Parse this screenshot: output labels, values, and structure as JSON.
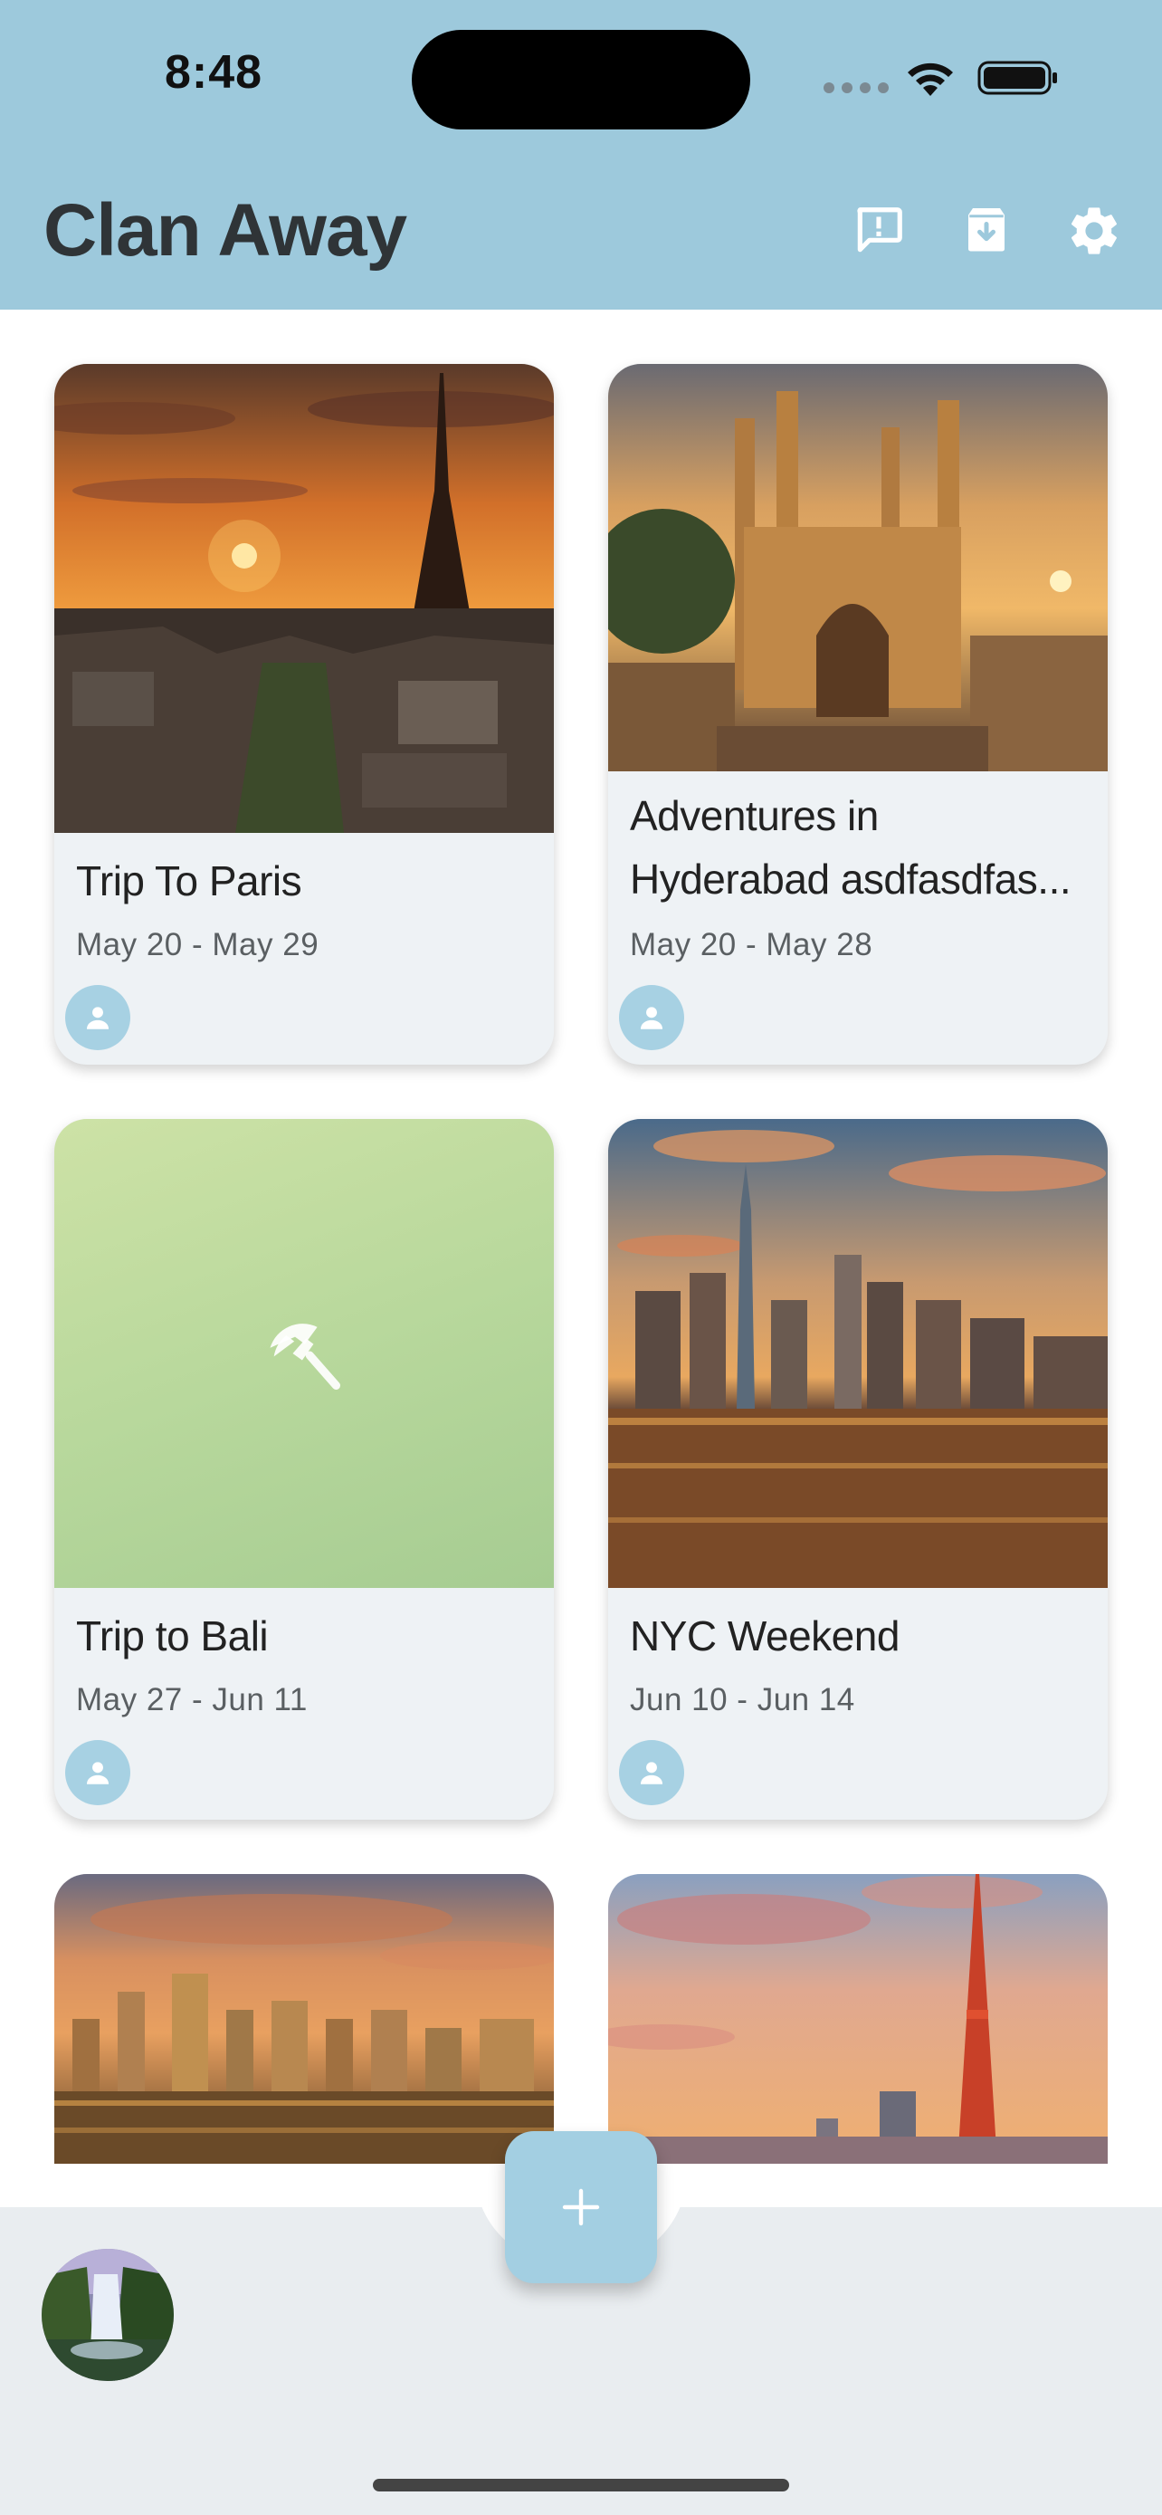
{
  "status_bar": {
    "time": "8:48"
  },
  "app": {
    "title": "Clan Away"
  },
  "header_icons": [
    "feedback-icon",
    "archive-download-icon",
    "settings-gear-icon"
  ],
  "trips": [
    {
      "title": "Trip To Paris",
      "dates": "May 20 - May 29",
      "image": "paris-eiffel-sunset"
    },
    {
      "title": "Adventures in",
      "title_line2": "Hyderabad asdfasdfas...",
      "dates": "May 20 - May 28",
      "image": "hyderabad-charminar-sunset"
    },
    {
      "title": "Trip to Bali",
      "dates": "May 27 - Jun 11",
      "image": "beach-umbrella-placeholder"
    },
    {
      "title": "NYC Weekend",
      "dates": "Jun 10 - Jun 14",
      "image": "nyc-skyline-sunset"
    },
    {
      "image": "vancouver-skyline-sunset"
    },
    {
      "image": "tokyo-tower-sunset"
    }
  ],
  "fab": {
    "icon": "plus-icon"
  },
  "colors": {
    "header": "#9dc9dc",
    "accent": "#a3cfe2",
    "card_bg": "#eef2f5",
    "bottom_bar": "#e9edf0"
  }
}
